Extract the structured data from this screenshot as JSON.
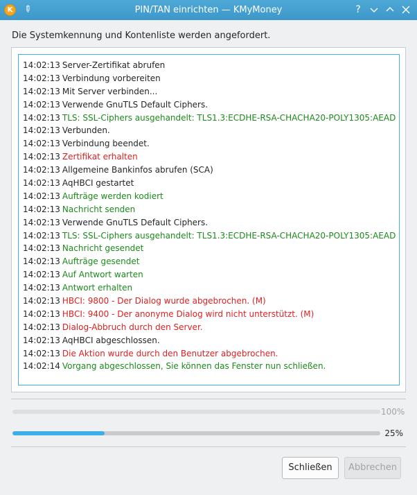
{
  "window": {
    "title": "PIN/TAN einrichten — KMyMoney"
  },
  "titlebar_icons": [
    "kmymoney-app-icon",
    "pin-icon",
    "help-icon",
    "minimize-icon",
    "maximize-icon",
    "close-icon"
  ],
  "status_message": "Die Systemkennung und Kontenliste werden angefordert.",
  "colors": {
    "normal": "#232627",
    "success": "#1b8a1b",
    "error": "#e02020",
    "accent": "#3daee9"
  },
  "log": [
    {
      "time": "14:02:13",
      "text": "Server-Zertifikat abrufen",
      "level": "normal"
    },
    {
      "time": "14:02:13",
      "text": "Verbindung vorbereiten",
      "level": "normal"
    },
    {
      "time": "14:02:13",
      "text": "Mit Server verbinden...",
      "level": "normal"
    },
    {
      "time": "14:02:13",
      "text": "Verwende GnuTLS Default Ciphers.",
      "level": "normal"
    },
    {
      "time": "14:02:13",
      "text": "TLS: SSL-Ciphers ausgehandelt: TLS1.3:ECDHE-RSA-CHACHA20-POLY1305:AEAD",
      "level": "success"
    },
    {
      "time": "14:02:13",
      "text": "Verbunden.",
      "level": "normal"
    },
    {
      "time": "14:02:13",
      "text": "Verbindung beendet.",
      "level": "normal"
    },
    {
      "time": "14:02:13",
      "text": "Zertifikat erhalten",
      "level": "error"
    },
    {
      "time": "14:02:13",
      "text": "Allgemeine Bankinfos abrufen (SCA)",
      "level": "normal"
    },
    {
      "time": "14:02:13",
      "text": "AqHBCI gestartet",
      "level": "normal"
    },
    {
      "time": "14:02:13",
      "text": "Aufträge werden kodiert",
      "level": "success"
    },
    {
      "time": "14:02:13",
      "text": "Nachricht senden",
      "level": "success"
    },
    {
      "time": "14:02:13",
      "text": "Verwende GnuTLS Default Ciphers.",
      "level": "normal"
    },
    {
      "time": "14:02:13",
      "text": "TLS: SSL-Ciphers ausgehandelt: TLS1.3:ECDHE-RSA-CHACHA20-POLY1305:AEAD",
      "level": "success"
    },
    {
      "time": "14:02:13",
      "text": "Nachricht gesendet",
      "level": "success"
    },
    {
      "time": "14:02:13",
      "text": "Aufträge gesendet",
      "level": "success"
    },
    {
      "time": "14:02:13",
      "text": "Auf Antwort warten",
      "level": "success"
    },
    {
      "time": "14:02:13",
      "text": "Antwort erhalten",
      "level": "success"
    },
    {
      "time": "14:02:13",
      "text": "HBCI: 9800 - Der Dialog wurde abgebrochen. (M)",
      "level": "error"
    },
    {
      "time": "14:02:13",
      "text": "HBCI: 9400 - Der anonyme Dialog wird nicht unterstützt. (M)",
      "level": "error"
    },
    {
      "time": "14:02:13",
      "text": "Dialog-Abbruch durch den Server.",
      "level": "error"
    },
    {
      "time": "14:02:13",
      "text": "AqHBCI abgeschlossen.",
      "level": "normal"
    },
    {
      "time": "14:02:13",
      "text": "Die Aktion wurde durch den Benutzer abgebrochen.",
      "level": "error"
    },
    {
      "time": "14:02:14",
      "text": "Vorgang abgeschlossen, Sie können das Fenster nun schließen.",
      "level": "success"
    }
  ],
  "progress": [
    {
      "label": "100%",
      "fraction": 1.0,
      "dimmed": true
    },
    {
      "label": "25%",
      "fraction": 0.25,
      "dimmed": false
    }
  ],
  "buttons": {
    "close_label": "Schließen",
    "cancel_label": "Abbrechen"
  }
}
